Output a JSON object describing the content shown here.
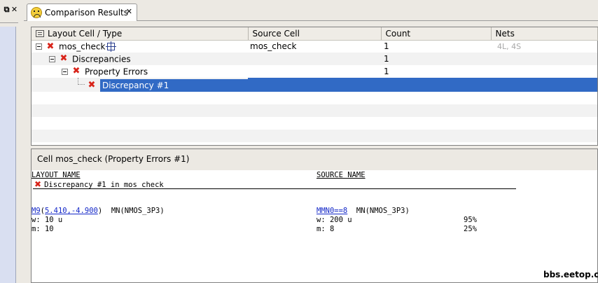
{
  "tab": {
    "label": "Comparison Results",
    "close_glyph": "✕"
  },
  "left_panel": {
    "controls": [
      "⧉",
      "✕"
    ]
  },
  "columns": [
    "Layout Cell / Type",
    "Source Cell",
    "Count",
    "Nets"
  ],
  "rows": [
    {
      "label": "mos_check",
      "source": "mos_check",
      "count": "1",
      "nets": "4L, 4S"
    },
    {
      "label": "Discrepancies",
      "source": "",
      "count": "1",
      "nets": ""
    },
    {
      "label": "Property Errors",
      "source": "",
      "count": "1",
      "nets": ""
    },
    {
      "label": "Discrepancy #1",
      "source": "",
      "count": "",
      "nets": ""
    }
  ],
  "detail": {
    "header": "Cell mos_check (Property Errors #1)",
    "layout_name_label": "LAYOUT NAME",
    "source_name_label": "SOURCE NAME",
    "discrepancy_line": "Discrepancy #1 in mos_check",
    "layout": {
      "device": "M9",
      "coords": "5.410,-4.900",
      "type": "MN(NMOS_3P3)",
      "w": "w: 10 u",
      "m": "m: 10"
    },
    "source": {
      "device": "MMN0==8",
      "type": "MN(NMOS_3P3)",
      "w": "w: 200 u",
      "m": "m: 8"
    },
    "pct_w": "95%",
    "pct_m": "25%"
  },
  "watermark": "bbs.eetop.cn"
}
